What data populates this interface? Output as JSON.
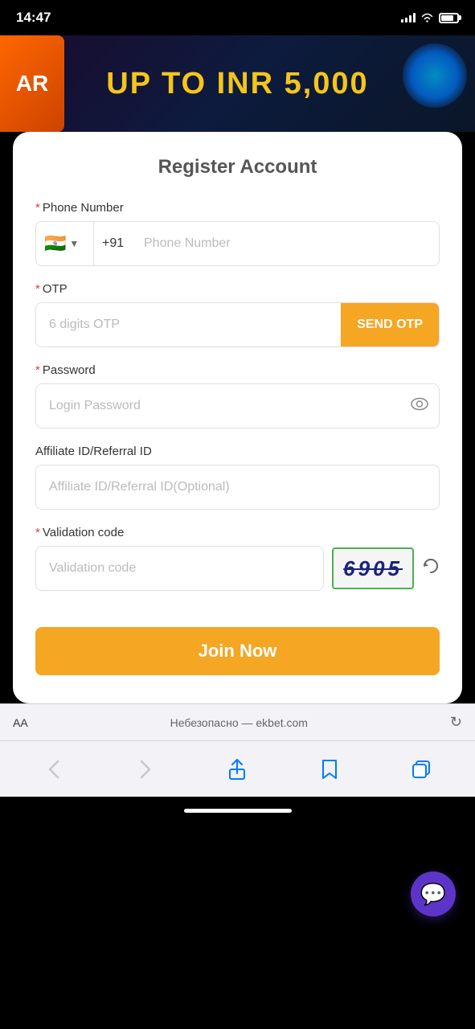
{
  "statusBar": {
    "time": "14:47"
  },
  "banner": {
    "arLabel": "AR",
    "text": "UP TO INR 5,000"
  },
  "form": {
    "title": "Register Account",
    "phoneField": {
      "label": "Phone Number",
      "required": true,
      "countryCode": "+91",
      "placeholder": "Phone Number"
    },
    "otpField": {
      "label": "OTP",
      "required": true,
      "placeholder": "6 digits OTP",
      "buttonLabel": "SEND OTP"
    },
    "passwordField": {
      "label": "Password",
      "required": true,
      "placeholder": "Login Password"
    },
    "affiliateField": {
      "label": "Affiliate ID/Referral ID",
      "required": false,
      "placeholder": "Affiliate ID/Referral ID(Optional)"
    },
    "validationField": {
      "label": "Validation code",
      "required": true,
      "placeholder": "Validation code",
      "captchaValue": "6905"
    },
    "joinButton": "Join Now"
  },
  "browserBar": {
    "aaLabel": "AA",
    "url": "Небезопасно — ekbet.com"
  },
  "bottomNav": {
    "back": "‹",
    "forward": "›",
    "share": "↑",
    "bookmark": "□",
    "tabs": "⧉"
  }
}
